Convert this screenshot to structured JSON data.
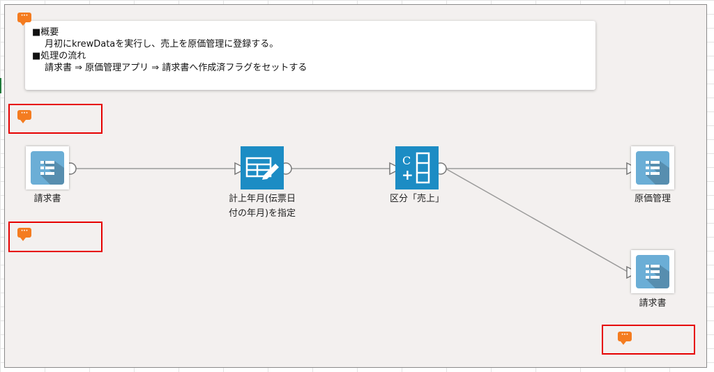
{
  "memo": {
    "overview_heading": "■概要",
    "overview_text": "月初にkrewDataを実行し、売上を原価管理に登録する。",
    "flow_heading": "■処理の流れ",
    "flow_text": "請求書 ⇒ 原価管理アプリ ⇒ 請求書へ作成済フラグをセットする"
  },
  "comment_icon_glyph": "···",
  "nodes": {
    "source": {
      "label": "請求書",
      "icon": "app-table-icon"
    },
    "edit": {
      "label_line1": "計上年月(伝票日",
      "label_line2": "付の年月)を指定",
      "icon": "table-edit-icon"
    },
    "filter": {
      "label": "区分「売上」",
      "icon": "calc-column-icon"
    },
    "output_cost": {
      "label": "原価管理",
      "icon": "app-table-icon"
    },
    "output_invoice": {
      "label": "請求書",
      "icon": "app-table-icon"
    }
  },
  "colors": {
    "comment_orange": "#f47c20",
    "highlight_red": "#e60000",
    "app_tile_blue": "#6baed6",
    "command_tile_blue": "#1c8cc4",
    "canvas_bg": "#f3f0ef"
  }
}
